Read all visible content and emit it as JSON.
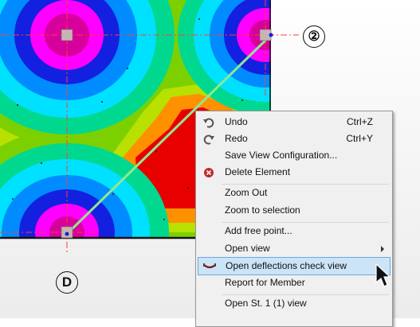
{
  "viewport": {
    "axis_labels": {
      "top": "②",
      "bottom": "D"
    },
    "contour_colors": [
      "#d8009c",
      "#ff00ff",
      "#1420e0",
      "#008cff",
      "#00e0ff",
      "#00d890",
      "#7cd000",
      "#b8e000",
      "#ff9000",
      "#e80000"
    ],
    "guide_color": "#ff3b3b",
    "section_line_color": "#90e890"
  },
  "context_menu": {
    "items": [
      {
        "label": "Undo",
        "shortcut": "Ctrl+Z",
        "icon": "undo-icon"
      },
      {
        "label": "Redo",
        "shortcut": "Ctrl+Y",
        "icon": "redo-icon"
      },
      {
        "label": "Save View Configuration...",
        "shortcut": ""
      },
      {
        "label": "Delete Element",
        "shortcut": "",
        "icon": "delete-icon"
      },
      {
        "label": "Zoom Out",
        "shortcut": ""
      },
      {
        "label": "Zoom to selection",
        "shortcut": ""
      },
      {
        "label": "Add free point...",
        "shortcut": ""
      },
      {
        "label": "Open view",
        "shortcut": "",
        "submenu": true
      },
      {
        "label": "Open deflections check view",
        "shortcut": "",
        "icon": "deflection-icon",
        "highlighted": true
      },
      {
        "label": "Report for Member",
        "shortcut": ""
      },
      {
        "label": "Open St. 1 (1) view",
        "shortcut": ""
      }
    ]
  }
}
